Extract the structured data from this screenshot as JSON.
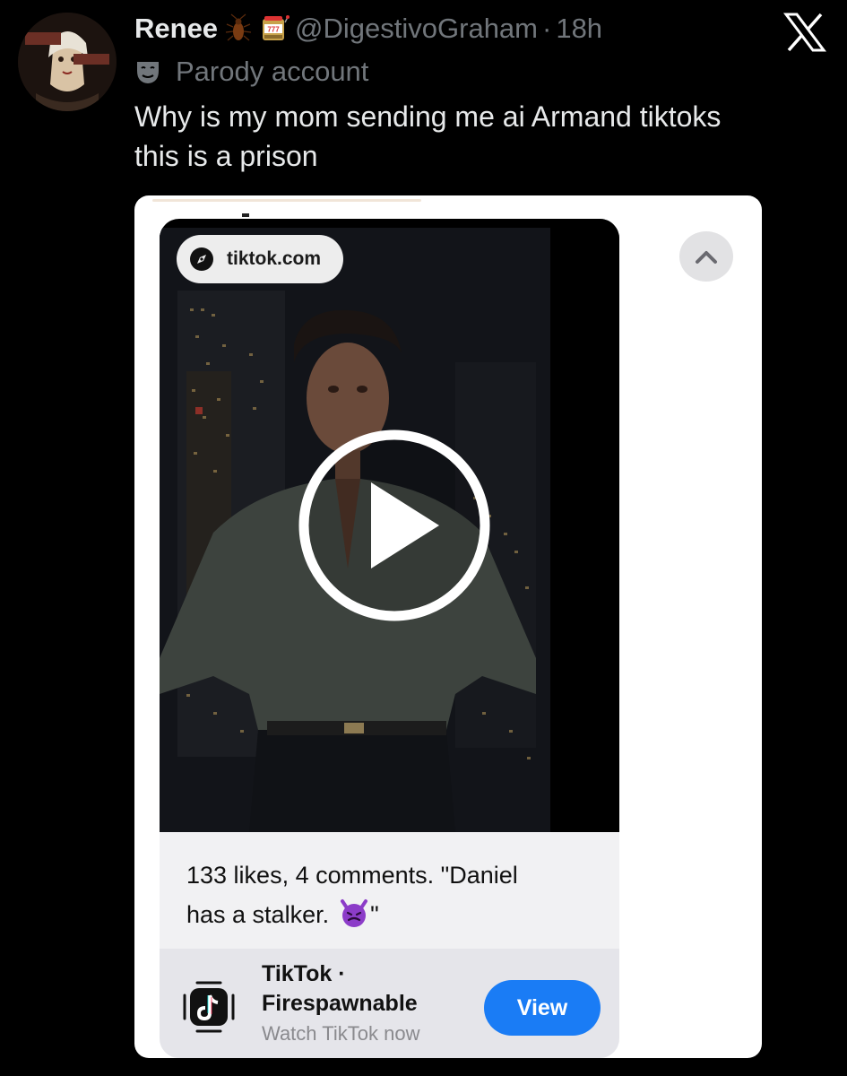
{
  "tweet": {
    "display_name": "Renee",
    "name_emojis": [
      "cockroach-icon",
      "slot-machine-icon"
    ],
    "handle": "@DigestivoGraham",
    "separator": "·",
    "time": "18h",
    "parody_label": "Parody account",
    "text_lines": [
      "Why is my mom sending me ai Armand tiktoks",
      "this is a prison"
    ]
  },
  "screenshot": {
    "url": "tiktok.com",
    "caption_lines": [
      "133 likes, 4 comments. \"Daniel",
      "has a stalker."
    ],
    "caption_end": "\"",
    "app": {
      "title": "TikTok ·",
      "subtitle": "Firespawnable",
      "note": "Watch TikTok now",
      "button_label": "View"
    }
  },
  "colors": {
    "background": "#000000",
    "muted": "#71767b",
    "button_blue": "#1a7cf5"
  }
}
